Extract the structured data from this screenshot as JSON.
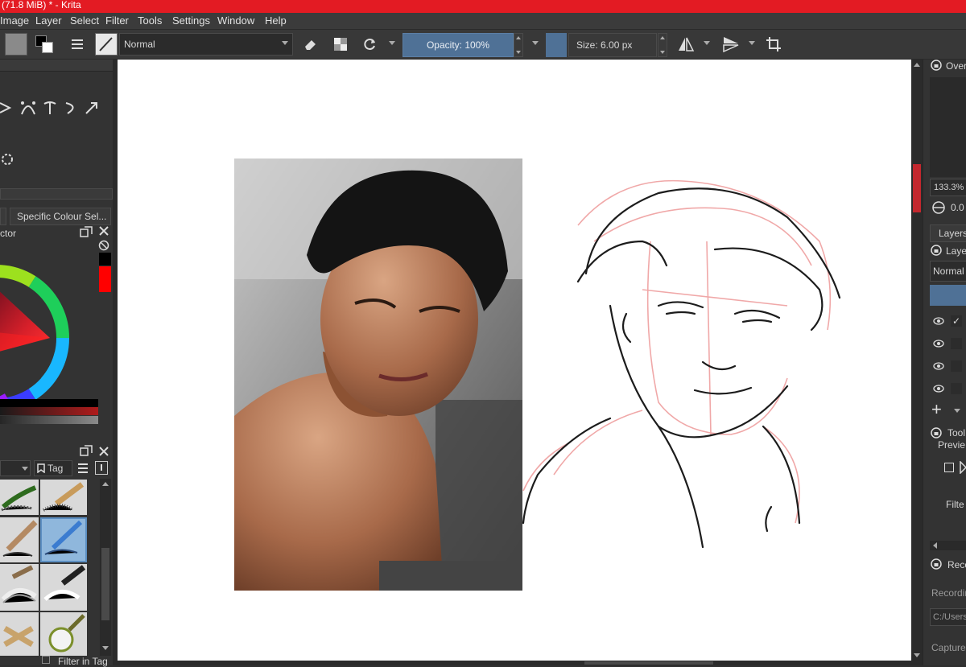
{
  "window": {
    "title": "(71.8 MiB) * - Krita",
    "accent": "#e31b23"
  },
  "menu": {
    "items": [
      "Image",
      "Layer",
      "Select",
      "Filter",
      "Tools",
      "Settings",
      "Window",
      "Help"
    ]
  },
  "toolbar": {
    "blend_mode": "Normal",
    "opacity_label": "Opacity: 100%",
    "size_label": "Size: 6.00 px",
    "brush_color": "#4f7196"
  },
  "left_dock": {
    "tab_label": "Specific Colour Sel...",
    "selector_label": "ctor",
    "tag_label": "Tag",
    "filter_in_tag": "Filter in Tag",
    "fg_color": "#000000",
    "bg_color": "#ff0000"
  },
  "right_dock": {
    "overview_label": "Over",
    "zoom_value": "133.3%",
    "rotation_value": "0.0",
    "layers_title": "Layers",
    "layers_sub": "Laye",
    "layers_blend": "Normal",
    "tool_label": "Tool",
    "preview_label": "Previe",
    "filter_label": "Filte",
    "recorder_label": "Reco",
    "recording_label": "Recordin",
    "path_value": "C:/Users",
    "capture_label": "Capture"
  }
}
